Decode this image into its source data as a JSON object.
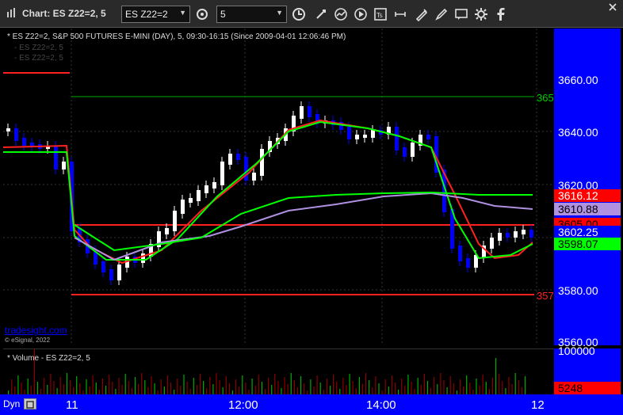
{
  "window": {
    "title": "Chart: ES Z22=2, 5",
    "symbol_input": "ES Z22=2",
    "interval_input": "5"
  },
  "chart": {
    "header": "* ES Z22=2, S&P 500 FUTURES E-MINI (DAY), 5, 09:30-16:15 (Since 2009-04-01 12:06:46 PM)",
    "ghost_label_1": "- ES Z22=2, 5",
    "ghost_label_2": "- ES Z22=2, 5",
    "watermark": "tradesight.com",
    "copyright": "© eSignal, 2022",
    "line_label_top": "365",
    "line_label_bottom": "357"
  },
  "y_axis": {
    "ticks": [
      "3660.00",
      "3640.00",
      "3620.00",
      "3580.00",
      "3560.00"
    ],
    "badges": [
      {
        "text": "3616.12",
        "bg": "#ff0000",
        "fg": "#ffffff"
      },
      {
        "text": "3610.88",
        "bg": "#b090e0",
        "fg": "#000000"
      },
      {
        "text": "3605.00",
        "bg": "#ff0000",
        "fg": "#000000"
      },
      {
        "text": "3602.25",
        "bg": "#0000ff",
        "fg": "#ffffff"
      },
      {
        "text": "3598.07",
        "bg": "#00ff00",
        "fg": "#000000"
      }
    ]
  },
  "volume": {
    "label": "* Volume - ES Z22=2, 5",
    "tick": "100000",
    "value_badge": "5248"
  },
  "x_axis": {
    "dyn": "Dyn",
    "labels": [
      "11",
      "12:00",
      "14:00",
      "12"
    ]
  },
  "colors": {
    "up": "#ffffff",
    "down": "#0000ff",
    "ma_red": "#ff2020",
    "ma_green": "#00ff00",
    "ma_purple": "#b090e0",
    "volume_bar": "#8b0000",
    "axis_bg": "#0000ff"
  },
  "icons": [
    "search-icon",
    "cursor-icon",
    "chart-line-icon",
    "play-icon",
    "time-frame-icon",
    "draw-icon",
    "chat-icon",
    "settings-icon",
    "facebook-icon"
  ]
}
